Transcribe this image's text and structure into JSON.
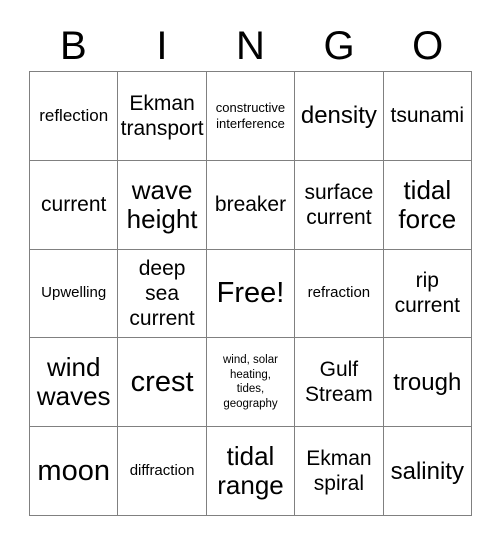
{
  "card": {
    "title": "BINGO",
    "free_space_label": "Free!",
    "colors": {
      "background": "#ffffff",
      "text": "#000000",
      "border": "#808080"
    },
    "header": {
      "letters": [
        "B",
        "I",
        "N",
        "G",
        "O"
      ]
    },
    "grid": {
      "rows": 5,
      "columns": 5,
      "cells": [
        {
          "text": "reflection",
          "size": "sm",
          "free": false
        },
        {
          "text": "Ekman\ntransport",
          "size": "md",
          "free": false
        },
        {
          "text": "constructive\ninterference",
          "size": "xxs",
          "free": false
        },
        {
          "text": "density",
          "size": "lg",
          "free": false
        },
        {
          "text": "tsunami",
          "size": "md",
          "free": false
        },
        {
          "text": "current",
          "size": "md",
          "free": false
        },
        {
          "text": "wave\nheight",
          "size": "xl",
          "free": false
        },
        {
          "text": "breaker",
          "size": "md",
          "free": false
        },
        {
          "text": "surface\ncurrent",
          "size": "md",
          "free": false
        },
        {
          "text": "tidal\nforce",
          "size": "xl",
          "free": false
        },
        {
          "text": "Upwelling",
          "size": "xs",
          "free": false
        },
        {
          "text": "deep\nsea\ncurrent",
          "size": "md",
          "free": false
        },
        {
          "text": "Free!",
          "size": "xxl",
          "free": true
        },
        {
          "text": "refraction",
          "size": "xs",
          "free": false
        },
        {
          "text": "rip\ncurrent",
          "size": "md",
          "free": false
        },
        {
          "text": "wind\nwaves",
          "size": "xl",
          "free": false
        },
        {
          "text": "crest",
          "size": "xxl",
          "free": false
        },
        {
          "text": "wind, solar\nheating,\ntides,\ngeography",
          "size": "tiny",
          "free": false
        },
        {
          "text": "Gulf\nStream",
          "size": "md",
          "free": false
        },
        {
          "text": "trough",
          "size": "lg",
          "free": false
        },
        {
          "text": "moon",
          "size": "xxl",
          "free": false
        },
        {
          "text": "diffraction",
          "size": "xs",
          "free": false
        },
        {
          "text": "tidal\nrange",
          "size": "xl",
          "free": false
        },
        {
          "text": "Ekman\nspiral",
          "size": "md",
          "free": false
        },
        {
          "text": "salinity",
          "size": "lg",
          "free": false
        }
      ]
    }
  }
}
